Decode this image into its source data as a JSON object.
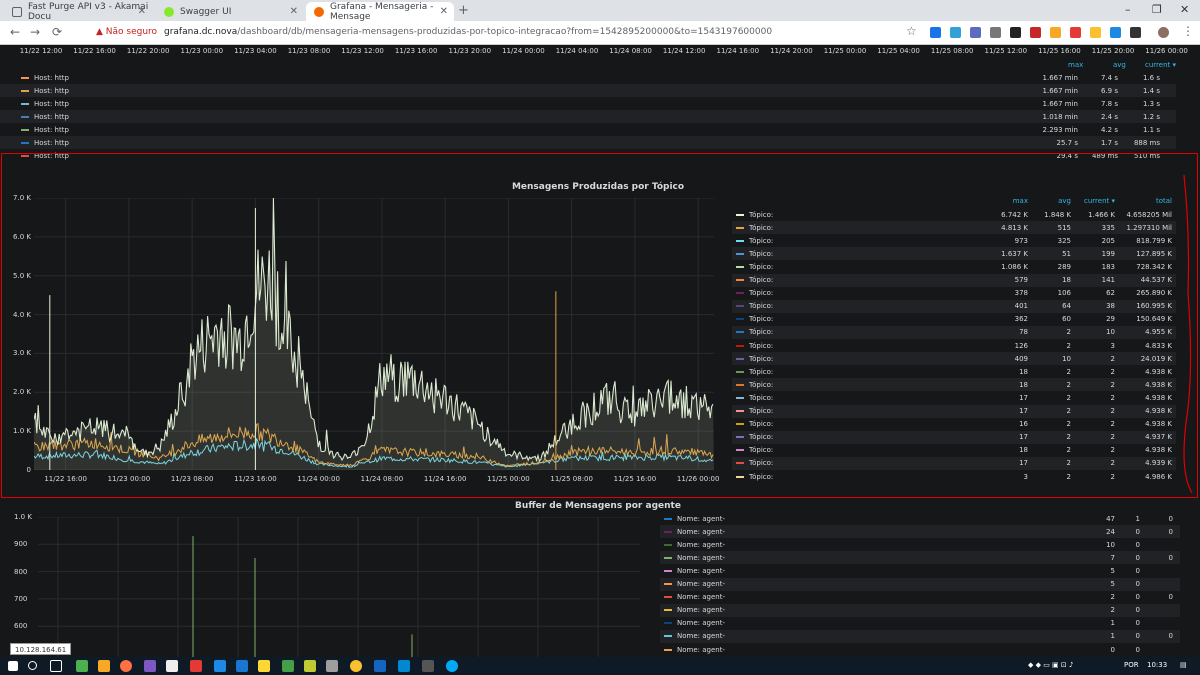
{
  "browser": {
    "tabs": [
      {
        "title": "Fast Purge API v3 - Akamai Docu",
        "icon_color": "#5f6368"
      },
      {
        "title": "Swagger UI",
        "icon_color": "#85ea2d"
      },
      {
        "title": "Grafana - Mensageria - Mensage",
        "icon_color": "#f46800"
      }
    ],
    "new_tab": "+",
    "security_label": "Não seguro",
    "url_host": "grafana.dc.nova",
    "url_path": "/dashboard/db/mensageria-mensagens-produzidas-por-topico-integracao?from=1542895200000&to=1543197600000",
    "window_controls": [
      "–",
      "❐",
      "✕"
    ],
    "nav": [
      "←",
      "→",
      "⟳"
    ]
  },
  "top_panel": {
    "xticks": [
      "11/22 12:00",
      "11/22 16:00",
      "11/22 20:00",
      "11/23 00:00",
      "11/23 04:00",
      "11/23 08:00",
      "11/23 12:00",
      "11/23 16:00",
      "11/23 20:00",
      "11/24 00:00",
      "11/24 04:00",
      "11/24 08:00",
      "11/24 12:00",
      "11/24 16:00",
      "11/24 20:00",
      "11/25 00:00",
      "11/25 04:00",
      "11/25 08:00",
      "11/25 12:00",
      "11/25 16:00",
      "11/25 20:00",
      "11/26 00:00"
    ],
    "headers": {
      "max": "max",
      "avg": "avg",
      "current": "current ▾"
    },
    "rows": [
      {
        "name": "Host: http",
        "color": "#f9934e",
        "max": "1.667 min",
        "avg": "7.4 s",
        "current": "1.6 s"
      },
      {
        "name": "Host: http",
        "color": "#e0a050",
        "max": "1.667 min",
        "avg": "6.9 s",
        "current": "1.4 s"
      },
      {
        "name": "Host: http",
        "color": "#82b5d8",
        "max": "1.667 min",
        "avg": "7.8 s",
        "current": "1.3 s"
      },
      {
        "name": "Host: http",
        "color": "#447ebc",
        "max": "1.018 min",
        "avg": "2.4 s",
        "current": "1.2 s"
      },
      {
        "name": "Host: http",
        "color": "#7eb26d",
        "max": "2.293 min",
        "avg": "4.2 s",
        "current": "1.1 s"
      },
      {
        "name": "Host: http",
        "color": "#1f78c1",
        "max": "25.7 s",
        "avg": "1.7 s",
        "current": "888 ms"
      },
      {
        "name": "Host: http",
        "color": "#e24d42",
        "max": "29.4 s",
        "avg": "489 ms",
        "current": "510 ms"
      }
    ]
  },
  "main_panel": {
    "title": "Mensagens Produzidas por Tópico",
    "headers": {
      "max": "max",
      "avg": "avg",
      "current": "current ▾",
      "total": "total"
    },
    "legend": [
      {
        "name": "Tópico:",
        "color": "#e5f4d9",
        "max": "6.742 K",
        "avg": "1.848 K",
        "current": "1.466 K",
        "total": "4.658205 Mil"
      },
      {
        "name": "Tópico:",
        "color": "#e5a340",
        "max": "4.813 K",
        "avg": "515",
        "current": "335",
        "total": "1.297310 Mil"
      },
      {
        "name": "Tópico:",
        "color": "#70dbed",
        "max": "973",
        "avg": "325",
        "current": "205",
        "total": "818.799 K"
      },
      {
        "name": "Tópico:",
        "color": "#5195ce",
        "max": "1.637 K",
        "avg": "51",
        "current": "199",
        "total": "127.895 K"
      },
      {
        "name": "Tópico:",
        "color": "#b7dbab",
        "max": "1.086 K",
        "avg": "289",
        "current": "183",
        "total": "728.342 K"
      },
      {
        "name": "Tópico:",
        "color": "#ef843c",
        "max": "579",
        "avg": "18",
        "current": "141",
        "total": "44.537 K"
      },
      {
        "name": "Tópico:",
        "color": "#6d1f62",
        "max": "378",
        "avg": "106",
        "current": "62",
        "total": "265.890 K"
      },
      {
        "name": "Tópico:",
        "color": "#584477",
        "max": "401",
        "avg": "64",
        "current": "38",
        "total": "160.995 K"
      },
      {
        "name": "Tópico:",
        "color": "#0a437c",
        "max": "362",
        "avg": "60",
        "current": "29",
        "total": "150.649 K"
      },
      {
        "name": "Tópico:",
        "color": "#1f78c1",
        "max": "78",
        "avg": "2",
        "current": "10",
        "total": "4.955 K"
      },
      {
        "name": "Tópico:",
        "color": "#bf1b00",
        "max": "126",
        "avg": "2",
        "current": "3",
        "total": "4.833 K"
      },
      {
        "name": "Tópico:",
        "color": "#705da0",
        "max": "409",
        "avg": "10",
        "current": "2",
        "total": "24.019 K"
      },
      {
        "name": "Tópico:",
        "color": "#629e51",
        "max": "18",
        "avg": "2",
        "current": "2",
        "total": "4.938 K"
      },
      {
        "name": "Tópico:",
        "color": "#e0752d",
        "max": "18",
        "avg": "2",
        "current": "2",
        "total": "4.938 K"
      },
      {
        "name": "Tópico:",
        "color": "#82b5d8",
        "max": "17",
        "avg": "2",
        "current": "2",
        "total": "4.938 K"
      },
      {
        "name": "Tópico:",
        "color": "#f29191",
        "max": "17",
        "avg": "2",
        "current": "2",
        "total": "4.938 K"
      },
      {
        "name": "Tópico:",
        "color": "#cca300",
        "max": "16",
        "avg": "2",
        "current": "2",
        "total": "4.938 K"
      },
      {
        "name": "Tópico:",
        "color": "#806eb7",
        "max": "17",
        "avg": "2",
        "current": "2",
        "total": "4.937 K"
      },
      {
        "name": "Tópico:",
        "color": "#d683ce",
        "max": "18",
        "avg": "2",
        "current": "2",
        "total": "4.938 K"
      },
      {
        "name": "Tópico:",
        "color": "#e24d42",
        "max": "17",
        "avg": "2",
        "current": "2",
        "total": "4.939 K"
      },
      {
        "name": "Tópico:",
        "color": "#f4d598",
        "max": "3",
        "avg": "2",
        "current": "2",
        "total": "4.986 K"
      }
    ]
  },
  "chart_data": [
    {
      "type": "line",
      "title": "Mensagens Produzidas por Tópico",
      "ylim": [
        0,
        7000
      ],
      "yticks": [
        "0",
        "1.0 K",
        "2.0 K",
        "3.0 K",
        "4.0 K",
        "5.0 K",
        "6.0 K",
        "7.0 K"
      ],
      "xticks": [
        "11/22 16:00",
        "11/23 00:00",
        "11/23 08:00",
        "11/23 16:00",
        "11/24 00:00",
        "11/24 08:00",
        "11/24 16:00",
        "11/25 00:00",
        "11/25 08:00",
        "11/25 16:00",
        "11/26 00:00"
      ],
      "grid": true,
      "series": [
        {
          "color": "#e5f4d9",
          "x": [
            "11/22 12:00",
            "11/22 14:00",
            "11/22 16:00",
            "11/22 20:00",
            "11/23 00:00",
            "11/23 02:00",
            "11/23 04:00",
            "11/23 06:00",
            "11/23 08:00",
            "11/23 10:00",
            "11/23 12:00",
            "11/23 14:00",
            "11/23 16:00",
            "11/23 18:00",
            "11/23 20:00",
            "11/23 22:00",
            "11/24 00:00",
            "11/24 02:00",
            "11/24 04:00",
            "11/24 06:00",
            "11/24 08:00",
            "11/24 12:00",
            "11/24 16:00",
            "11/24 20:00",
            "11/25 00:00",
            "11/25 04:00",
            "11/25 08:00",
            "11/25 12:00",
            "11/25 16:00",
            "11/25 20:00",
            "11/26 00:00",
            "11/26 02:00"
          ],
          "values": [
            1200,
            800,
            900,
            1100,
            800,
            400,
            600,
            1500,
            2800,
            3300,
            3600,
            3200,
            4500,
            4800,
            3400,
            2200,
            700,
            400,
            300,
            800,
            2400,
            2300,
            1800,
            1200,
            400,
            300,
            1200,
            1800,
            1500,
            1900,
            1700,
            1400
          ]
        },
        {
          "color": "#e5a340",
          "x": [
            "11/22 12:00",
            "11/22 20:00",
            "11/23 00:00",
            "11/23 04:00",
            "11/23 08:00",
            "11/23 12:00",
            "11/23 16:00",
            "11/23 20:00",
            "11/24 00:00",
            "11/24 04:00",
            "11/24 08:00",
            "11/24 12:00",
            "11/24 16:00",
            "11/24 20:00",
            "11/25 00:00",
            "11/25 04:00",
            "11/25 08:00",
            "11/25 12:00",
            "11/25 16:00",
            "11/25 20:00",
            "11/26 00:00",
            "11/26 02:00"
          ],
          "values": [
            600,
            700,
            500,
            300,
            700,
            900,
            1000,
            700,
            200,
            100,
            500,
            450,
            400,
            350,
            100,
            200,
            450,
            500,
            450,
            500,
            450,
            350
          ]
        },
        {
          "color": "#70dbed",
          "x": [
            "11/22 12:00",
            "11/22 20:00",
            "11/23 00:00",
            "11/23 04:00",
            "11/23 08:00",
            "11/23 12:00",
            "11/23 16:00",
            "11/23 20:00",
            "11/24 00:00",
            "11/24 04:00",
            "11/24 08:00",
            "11/24 16:00",
            "11/24 20:00",
            "11/25 00:00",
            "11/25 08:00",
            "11/25 16:00",
            "11/25 20:00",
            "11/26 00:00",
            "11/26 02:00"
          ],
          "values": [
            350,
            400,
            250,
            150,
            450,
            600,
            650,
            500,
            150,
            80,
            300,
            260,
            200,
            80,
            300,
            320,
            330,
            280,
            210
          ]
        }
      ]
    },
    {
      "type": "bar",
      "title": "Buffer de Mensagens por agente",
      "ylim": [
        500,
        1000
      ],
      "yticks": [
        "600",
        "700",
        "800",
        "900",
        "1.0 K"
      ],
      "grid": true,
      "series": [
        {
          "color": "#7eb26d",
          "values": [
            930,
            850,
            570
          ]
        }
      ]
    }
  ],
  "buffer_panel": {
    "title": "Buffer de Mensagens por agente",
    "legend": [
      {
        "name": "Nome: agent-",
        "color": "#1f78c1",
        "v1": "47",
        "v2": "1",
        "v3": "0"
      },
      {
        "name": "Nome: agent-",
        "color": "#6d1f62",
        "v1": "24",
        "v2": "0",
        "v3": "0"
      },
      {
        "name": "Nome: agent-",
        "color": "#3f6833",
        "v1": "10",
        "v2": "0",
        "v3": ""
      },
      {
        "name": "Nome: agent-",
        "color": "#7eb26d",
        "v1": "7",
        "v2": "0",
        "v3": "0"
      },
      {
        "name": "Nome: agent-",
        "color": "#d683ce",
        "v1": "5",
        "v2": "0",
        "v3": ""
      },
      {
        "name": "Nome: agent-",
        "color": "#f9934e",
        "v1": "5",
        "v2": "0",
        "v3": ""
      },
      {
        "name": "Nome: agent-",
        "color": "#e24d42",
        "v1": "2",
        "v2": "0",
        "v3": "0"
      },
      {
        "name": "Nome: agent-",
        "color": "#eab839",
        "v1": "2",
        "v2": "0",
        "v3": ""
      },
      {
        "name": "Nome: agent-",
        "color": "#0a437c",
        "v1": "1",
        "v2": "0",
        "v3": ""
      },
      {
        "name": "Nome: agent-",
        "color": "#65c5db",
        "v1": "1",
        "v2": "0",
        "v3": "0"
      },
      {
        "name": "Nome: agent-",
        "color": "#e0a050",
        "v1": "0",
        "v2": "0",
        "v3": ""
      }
    ]
  },
  "status": {
    "ip": "10.128.164.61"
  },
  "taskbar": {
    "lang": "POR",
    "time": "10:33"
  }
}
